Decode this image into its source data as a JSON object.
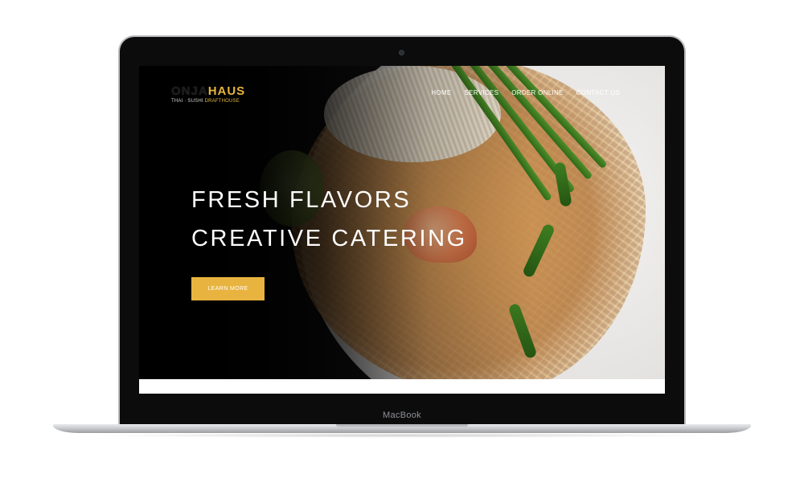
{
  "device": {
    "label": "MacBook"
  },
  "site": {
    "logo": {
      "primary_left": "ONJA",
      "primary_right": "HAUS",
      "secondary_left": "THAI · SUSHI ",
      "secondary_right": "DRAFTHOUSE"
    },
    "nav": [
      {
        "label": "HOME"
      },
      {
        "label": "SERVICES"
      },
      {
        "label": "ORDER ONLINE"
      },
      {
        "label": "CONTACT US"
      }
    ],
    "hero": {
      "line1": "FRESH FLAVORS",
      "line2": "CREATIVE CATERING",
      "cta_label": "LEARN MORE"
    }
  },
  "colors": {
    "accent": "#e8b33f",
    "nav_text": "#ffffff",
    "hero_overlay": "#000000"
  }
}
